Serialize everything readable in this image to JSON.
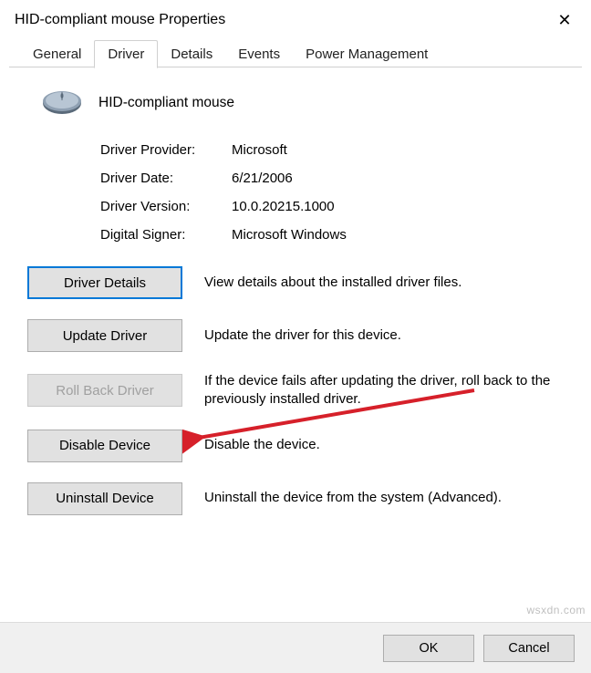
{
  "window": {
    "title": "HID-compliant mouse Properties"
  },
  "tabs": {
    "general": "General",
    "driver": "Driver",
    "details": "Details",
    "events": "Events",
    "power": "Power Management"
  },
  "device": {
    "name": "HID-compliant mouse"
  },
  "info": {
    "provider_label": "Driver Provider:",
    "provider_value": "Microsoft",
    "date_label": "Driver Date:",
    "date_value": "6/21/2006",
    "version_label": "Driver Version:",
    "version_value": "10.0.20215.1000",
    "signer_label": "Digital Signer:",
    "signer_value": "Microsoft Windows"
  },
  "actions": {
    "details_btn": "Driver Details",
    "details_desc": "View details about the installed driver files.",
    "update_btn": "Update Driver",
    "update_desc": "Update the driver for this device.",
    "rollback_btn": "Roll Back Driver",
    "rollback_desc": "If the device fails after updating the driver, roll back to the previously installed driver.",
    "disable_btn": "Disable Device",
    "disable_desc": "Disable the device.",
    "uninstall_btn": "Uninstall Device",
    "uninstall_desc": "Uninstall the device from the system (Advanced)."
  },
  "footer": {
    "ok": "OK",
    "cancel": "Cancel"
  },
  "watermark": "wsxdn.com"
}
